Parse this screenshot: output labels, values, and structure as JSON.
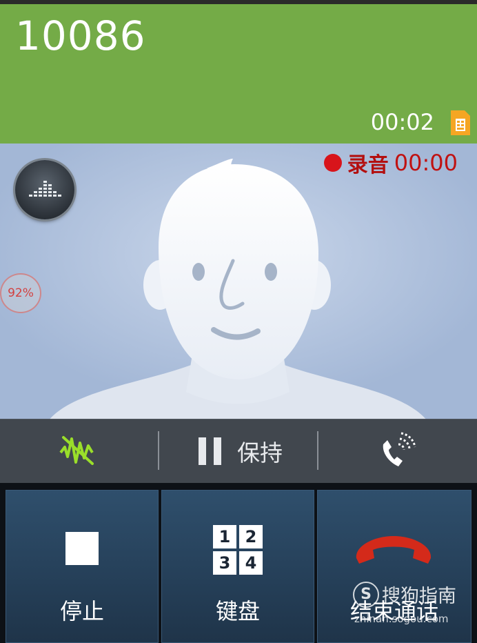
{
  "call": {
    "number": "10086",
    "duration": "00:02"
  },
  "recording": {
    "label": "录音",
    "time": "00:00",
    "color": "#d8141b"
  },
  "percent_badge": "92%",
  "controls": {
    "hold_label": "保持"
  },
  "buttons": {
    "stop_label": "停止",
    "keypad_label": "键盘",
    "end_call_label": "结束通话",
    "keypad_digits": [
      "1",
      "2",
      "3",
      "4"
    ]
  },
  "watermark": {
    "text": "搜狗指南",
    "logo": "S",
    "url": "zhinan.sogou.com"
  },
  "colors": {
    "header_bg": "#74ab47",
    "photo_bg": "#a3b7d6",
    "button_bg": "#2a4863",
    "hangup": "#d42a1a"
  }
}
